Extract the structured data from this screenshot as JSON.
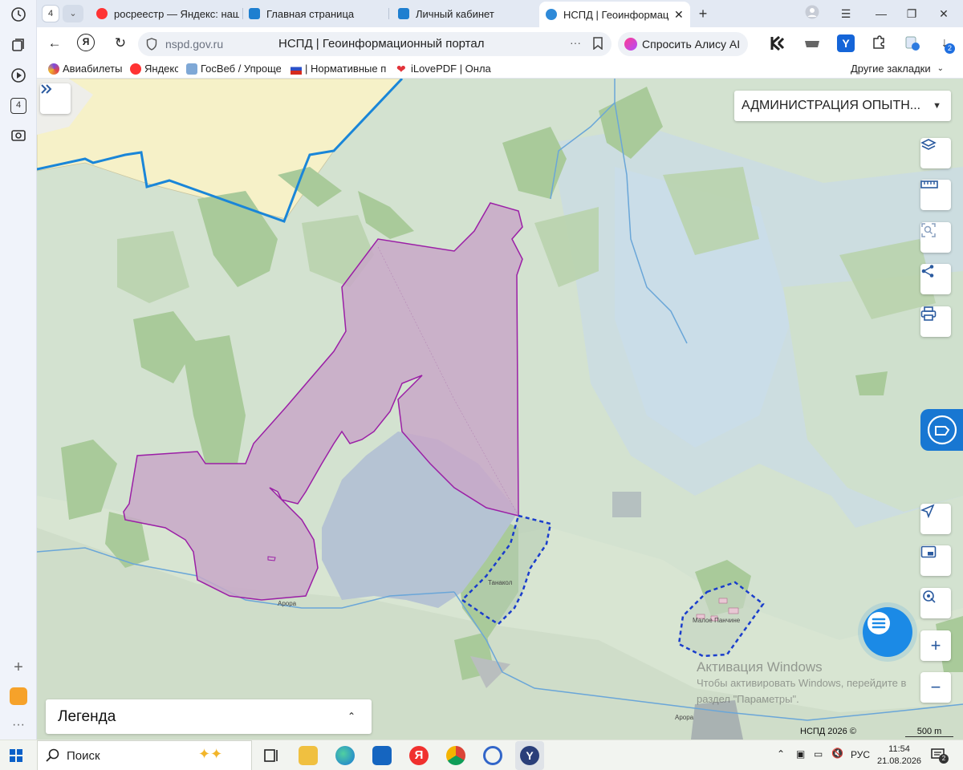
{
  "browser": {
    "tab_count": "4",
    "tabs": [
      {
        "label": "росреестр — Яндекс: наш",
        "favicon": "yandex-icon",
        "active": false
      },
      {
        "label": "Главная страница",
        "favicon": "rosreestr-icon",
        "active": false
      },
      {
        "label": "Личный кабинет",
        "favicon": "rosreestr-icon",
        "active": false
      },
      {
        "label": "НСПД | Геоинформаци",
        "favicon": "nspd-icon",
        "active": true
      }
    ],
    "url": "nspd.gov.ru",
    "page_title": "НСПД | Геоинформационный портал",
    "alice_label": "Спросить Алису AI",
    "downloads_badge": "2",
    "bookmarks": [
      {
        "label": "Авиабилеты"
      },
      {
        "label": "Яндекс"
      },
      {
        "label": "ГосВеб / Упрощен"
      },
      {
        "label": "| Нормативные пр"
      },
      {
        "label": "iLovePDF | Онлай"
      }
    ],
    "other_bookmarks": "Другие закладки",
    "sidebar_badge": "4"
  },
  "map": {
    "admin_select": "АДМИНИСТРАЦИЯ ОПЫТН...",
    "legend_label": "Легенда",
    "copyright": "НСПД 2026 ©",
    "scale": "500 m",
    "places": [
      "Танакол",
      "Малое Панчине",
      "Арора",
      "Арора"
    ],
    "watermark": {
      "title": "Активация Windows",
      "line1": "Чтобы активировать Windows, перейдите в",
      "line2": "раздел \"Параметры\"."
    },
    "colors": {
      "parcel_fill": "#c8a8c8",
      "parcel_stroke": "#9b1fa6",
      "boundary": "#1a86d8",
      "settlement_stroke": "#1a3dcc",
      "water": "#c9dbe9",
      "lake": "#b5c3d3"
    }
  },
  "taskbar": {
    "search_label": "Поиск",
    "lang": "РУС",
    "time": "11:54",
    "date": "21.08.2026",
    "notif_badge": "2"
  }
}
